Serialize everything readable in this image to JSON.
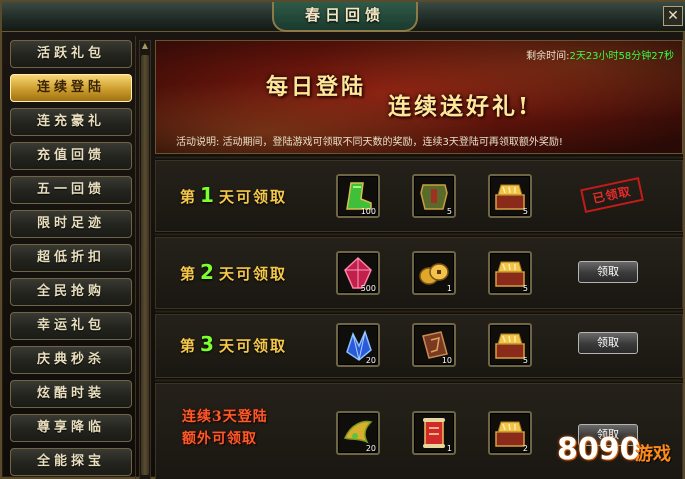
{
  "window": {
    "title": "春日回馈",
    "close_label": "✕"
  },
  "sidebar": {
    "items": [
      {
        "label": "活跃礼包",
        "active": false
      },
      {
        "label": "连续登陆",
        "active": true
      },
      {
        "label": "连充豪礼",
        "active": false
      },
      {
        "label": "充值回馈",
        "active": false
      },
      {
        "label": "五一回馈",
        "active": false
      },
      {
        "label": "限时足迹",
        "active": false
      },
      {
        "label": "超低折扣",
        "active": false
      },
      {
        "label": "全民抢购",
        "active": false
      },
      {
        "label": "幸运礼包",
        "active": false
      },
      {
        "label": "庆典秒杀",
        "active": false
      },
      {
        "label": "炫酷时装",
        "active": false
      },
      {
        "label": "尊享降临",
        "active": false
      },
      {
        "label": "全能探宝",
        "active": false
      }
    ]
  },
  "banner": {
    "remaining_label": "剩余时间:",
    "remaining_value": "2天23小时58分钟27秒",
    "headline_1": "每日登陆",
    "headline_2": "连续送好礼!",
    "activity_desc": "活动说明:  活动期间，登陆游戏可领取不同天数的奖励，连续3天登陆可再领取额外奖励!"
  },
  "rewards": {
    "day_prefix": "第",
    "day_suffix": "天可领取",
    "rows": [
      {
        "day": "1",
        "items": [
          {
            "icon": "green-boot-icon",
            "count": "100"
          },
          {
            "icon": "armor-chest-icon",
            "count": "5"
          },
          {
            "icon": "gold-treasure-box-icon",
            "count": "5"
          }
        ],
        "status": "已领取"
      },
      {
        "day": "2",
        "items": [
          {
            "icon": "red-crystal-icon",
            "count": "500"
          },
          {
            "icon": "gold-coin-icon",
            "count": "1"
          },
          {
            "icon": "gold-treasure-box-icon",
            "count": "5"
          }
        ],
        "button": "领取"
      },
      {
        "day": "3",
        "items": [
          {
            "icon": "blue-crystal-icon",
            "count": "20"
          },
          {
            "icon": "rune-book-icon",
            "count": "10"
          },
          {
            "icon": "gold-treasure-box-icon",
            "count": "5"
          }
        ],
        "button": "领取"
      }
    ],
    "bonus": {
      "label_line1": "连续3天登陆",
      "label_line2": "额外可领取",
      "items": [
        {
          "icon": "gold-wing-icon",
          "count": "20"
        },
        {
          "icon": "red-scroll-icon",
          "count": "1"
        },
        {
          "icon": "gold-treasure-box-icon",
          "count": "2"
        }
      ],
      "button": "领取"
    }
  },
  "watermark": {
    "number": "8090",
    "text": "游戏"
  },
  "colors": {
    "active_tab": "#e0b040",
    "day_number": "#7cff2e",
    "remaining_value": "#33ff44",
    "bonus_text": "#ff5a2a",
    "claimed_stamp": "#d42020"
  }
}
